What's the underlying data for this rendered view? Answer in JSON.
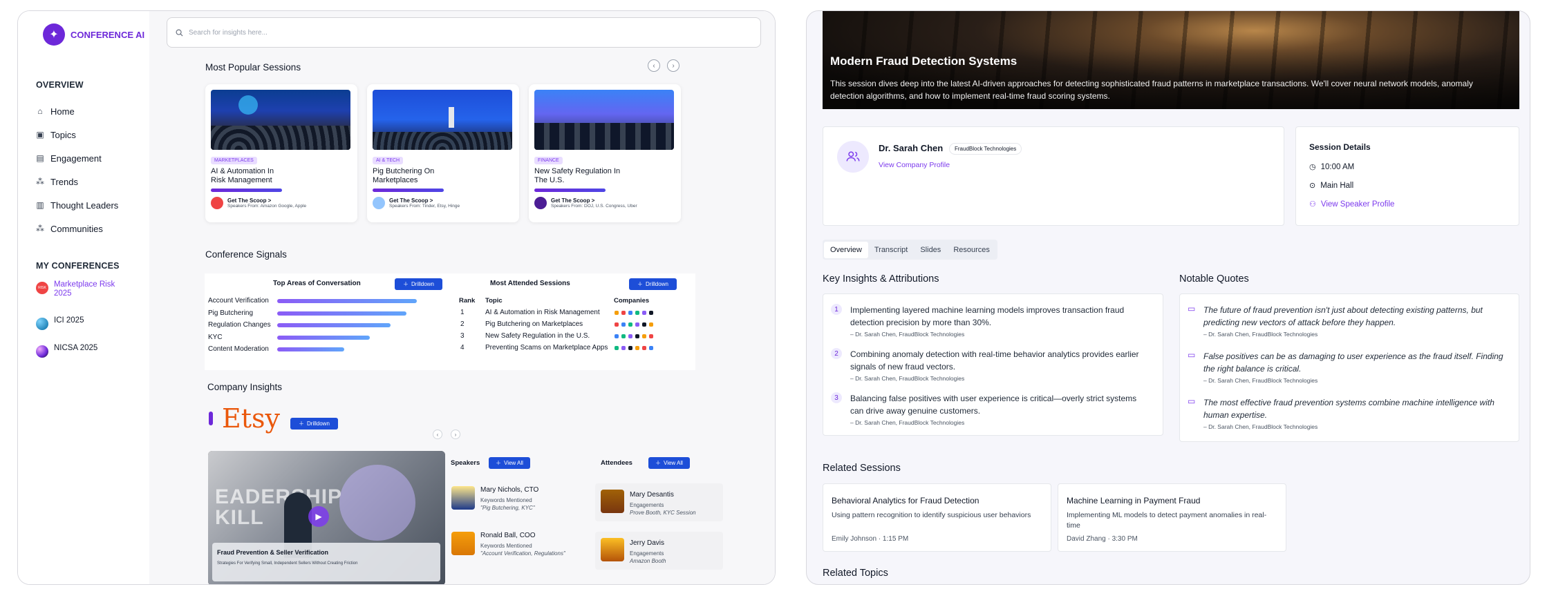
{
  "app": {
    "brand": "CONFERENCE AI"
  },
  "search": {
    "placeholder": "Search for insights here..."
  },
  "sidebar": {
    "overview_heading": "OVERVIEW",
    "items": [
      {
        "label": "Home",
        "icon": "home-icon"
      },
      {
        "label": "Topics",
        "icon": "topics-icon"
      },
      {
        "label": "Engagement",
        "icon": "engagement-icon"
      },
      {
        "label": "Trends",
        "icon": "trends-icon"
      },
      {
        "label": "Thought Leaders",
        "icon": "thought-leaders-icon"
      },
      {
        "label": "Communities",
        "icon": "communities-icon"
      }
    ],
    "conferences_heading": "MY CONFERENCES",
    "conferences": [
      {
        "label": "Marketplace Risk 2025",
        "color": "#ef4444",
        "badge": "RISK"
      },
      {
        "label": "ICI 2025",
        "color": "#0ea5e9"
      },
      {
        "label": "NICSA 2025",
        "color": "#7c3aed"
      }
    ]
  },
  "popular": {
    "title": "Most Popular Sessions",
    "cards": [
      {
        "tag": "MARKETPLACES",
        "title": "AI & Automation In Risk Management",
        "scoop": "Get The Scoop >",
        "speakers": "Speakers From: Amazon Google, Apple"
      },
      {
        "tag": "AI & TECH",
        "title": "Pig Butchering On Marketplaces",
        "scoop": "Get The Scoop >",
        "speakers": "Speakers From: Tinder, Etsy, Hinge"
      },
      {
        "tag": "FINANCE",
        "title": "New Safety Regulation In The U.S.",
        "scoop": "Get The Scoop >",
        "speakers": "Speakers From: DOJ, U.S. Congress, Uber"
      }
    ]
  },
  "signals": {
    "title": "Conference Signals",
    "areas_title": "Top Areas of Conversation",
    "drilldown": "Drilldown",
    "areas": [
      {
        "label": "Account Verification",
        "value": 0.96
      },
      {
        "label": "Pig Butchering",
        "value": 0.89
      },
      {
        "label": "Regulation Changes",
        "value": 0.78
      },
      {
        "label": "KYC",
        "value": 0.64
      },
      {
        "label": "Content Moderation",
        "value": 0.46
      }
    ],
    "attended_title": "Most Attended Sessions",
    "cols": [
      "Rank",
      "Topic",
      "Companies"
    ],
    "rows": [
      {
        "rank": "1",
        "topic": "AI & Automation in Risk Management"
      },
      {
        "rank": "2",
        "topic": "Pig Butchering on Marketplaces"
      },
      {
        "rank": "3",
        "topic": "New Safety Regulation in the U.S."
      },
      {
        "rank": "4",
        "topic": "Preventing Scams on Marketplace Apps"
      }
    ]
  },
  "company": {
    "title": "Company Insights",
    "logo": "Etsy",
    "drilldown": "Drilldown",
    "video_title": "Fraud Prevention & Seller Verification",
    "video_sub": "Strategies For Verifying Small, Independent Sellers Without Creating Friction",
    "video_bg_text": "EADERSHIP KILL",
    "speakers_title": "Speakers",
    "attendees_title": "Attendees",
    "view_all": "View All",
    "speakers": [
      {
        "name": "Mary Nichols, CTO",
        "k": "Keywords Mentioned",
        "q": "\"Pig Butchering, KYC\""
      },
      {
        "name": "Ronald Ball, COO",
        "k": "Keywords Mentioned",
        "q": "\"Account Verification, Regulations\""
      }
    ],
    "attendees": [
      {
        "name": "Mary Desantis",
        "k": "Engagements",
        "q": "Prove Booth, KYC Session"
      },
      {
        "name": "Jerry Davis",
        "k": "Engagements",
        "q": "Amazon Booth"
      }
    ]
  },
  "detail": {
    "hero_title": "Modern Fraud Detection Systems",
    "hero_desc": "This session dives deep into the latest AI-driven approaches for detecting sophisticated fraud patterns in marketplace transactions. We'll cover neural network models, anomaly detection algorithms, and how to implement real-time fraud scoring systems.",
    "speaker_name": "Dr. Sarah Chen",
    "speaker_company": "FraudBlock Technologies",
    "view_company": "View Company Profile",
    "session_details_title": "Session Details",
    "time": "10:00 AM",
    "location": "Main Hall",
    "view_speaker": "View Speaker Profile",
    "tabs": [
      "Overview",
      "Transcript",
      "Slides",
      "Resources"
    ],
    "insights_title": "Key Insights & Attributions",
    "insights": [
      {
        "n": "1",
        "text": "Implementing layered machine learning models improves transaction fraud detection precision by more than 30%.",
        "src": "– Dr. Sarah Chen, FraudBlock Technologies"
      },
      {
        "n": "2",
        "text": "Combining anomaly detection with real-time behavior analytics provides earlier signals of new fraud vectors.",
        "src": "– Dr. Sarah Chen, FraudBlock Technologies"
      },
      {
        "n": "3",
        "text": "Balancing false positives with user experience is critical—overly strict systems can drive away genuine customers.",
        "src": "– Dr. Sarah Chen, FraudBlock Technologies"
      }
    ],
    "quotes_title": "Notable Quotes",
    "quotes": [
      {
        "text": "The future of fraud prevention isn't just about detecting existing patterns, but predicting new vectors of attack before they happen.",
        "src": "– Dr. Sarah Chen, FraudBlock Technologies"
      },
      {
        "text": "False positives can be as damaging to user experience as the fraud itself. Finding the right balance is critical.",
        "src": "– Dr. Sarah Chen, FraudBlock Technologies"
      },
      {
        "text": "The most effective fraud prevention systems combine machine intelligence with human expertise.",
        "src": "– Dr. Sarah Chen, FraudBlock Technologies"
      }
    ],
    "related_title": "Related Sessions",
    "related": [
      {
        "title": "Behavioral Analytics for Fraud Detection",
        "desc": "Using pattern recognition to identify suspicious user behaviors",
        "meta": "Emily Johnson · 1:15 PM"
      },
      {
        "title": "Machine Learning in Payment Fraud",
        "desc": "Implementing ML models to detect payment anomalies in real-time",
        "meta": "David Zhang · 3:30 PM"
      }
    ],
    "related_topics_title": "Related Topics"
  },
  "colors": {
    "accent": "#6d28d9",
    "primary_button": "#1d4ed8",
    "etsy": "#ea580c"
  }
}
